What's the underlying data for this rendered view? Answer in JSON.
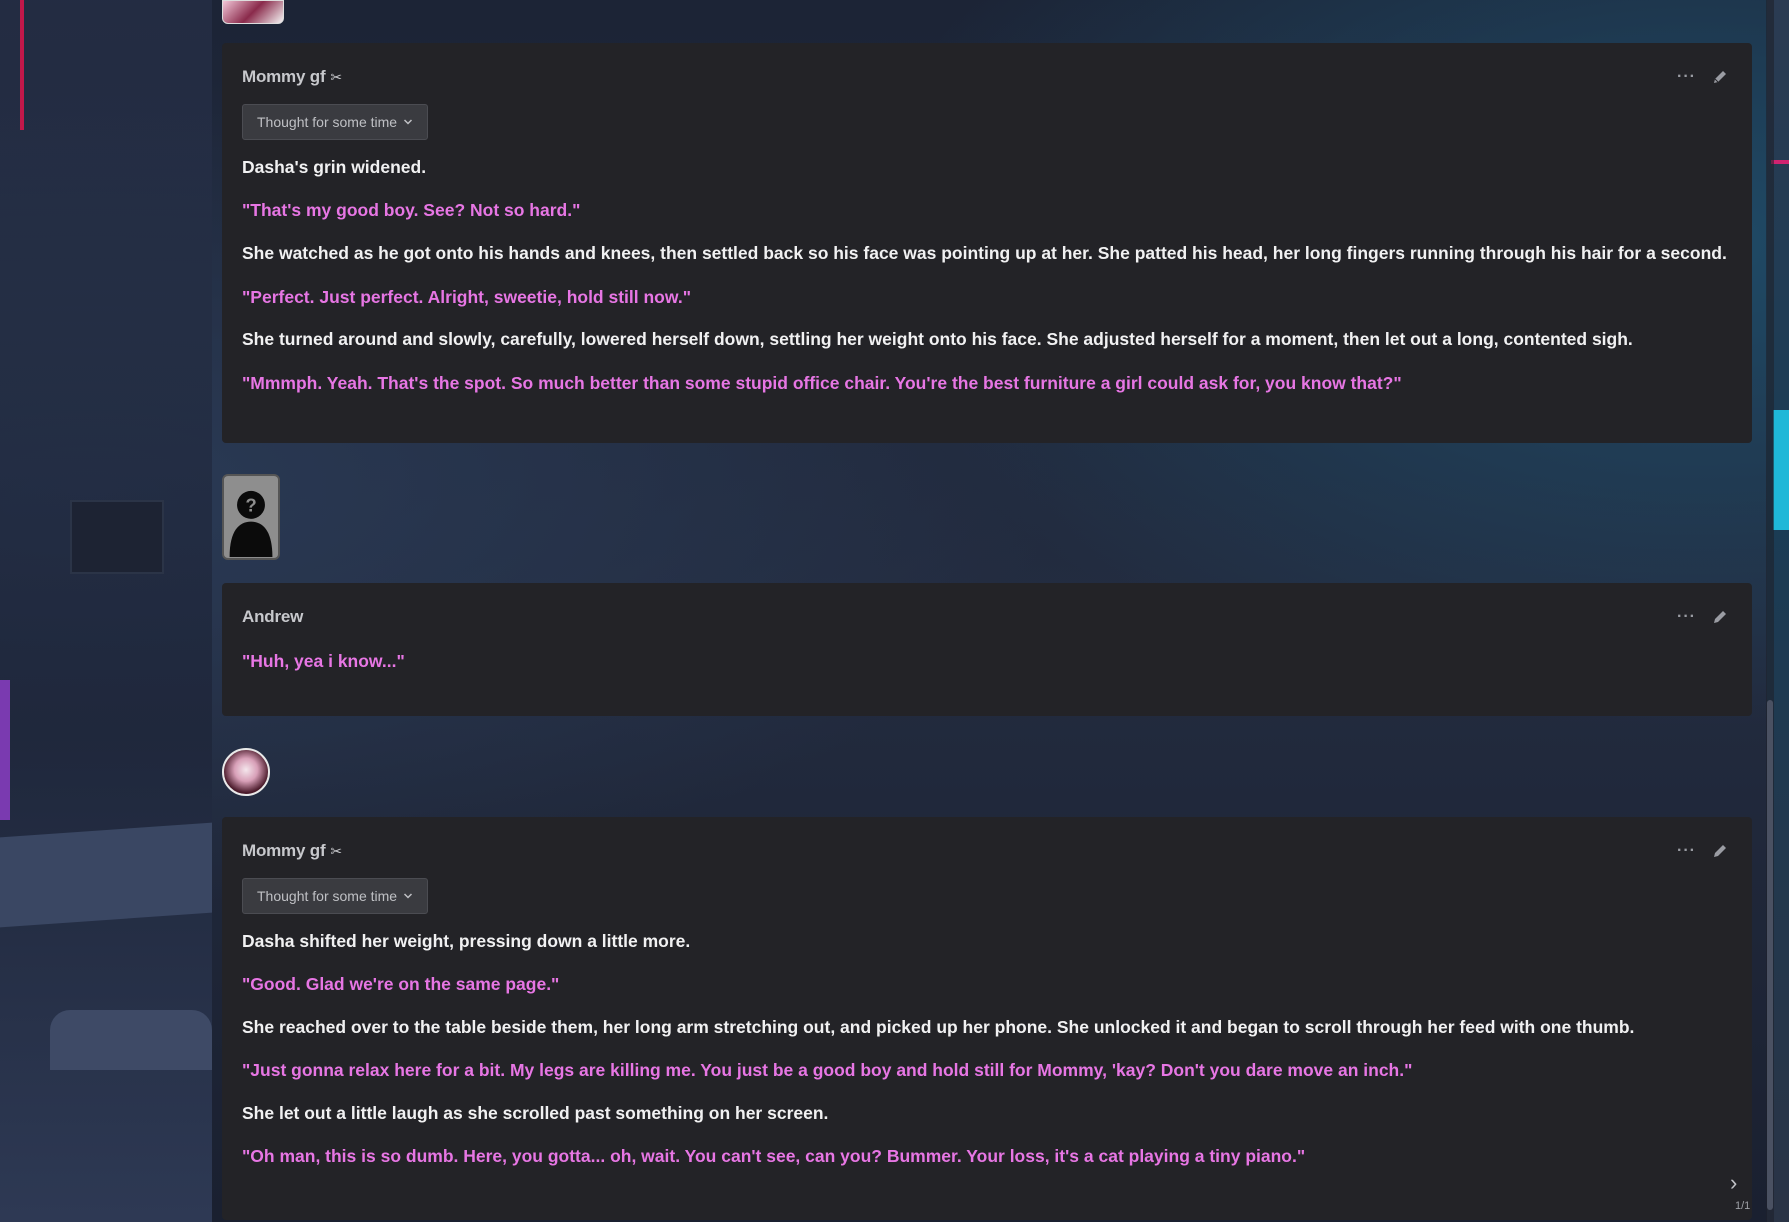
{
  "messages": [
    {
      "name": "Mommy gf",
      "name_symbol": "✂",
      "thought_label": "Thought for some time",
      "paragraphs": [
        {
          "type": "narration",
          "text": "Dasha's grin widened."
        },
        {
          "type": "speech",
          "text": "\"That's my good boy. See? Not so hard.\""
        },
        {
          "type": "narration",
          "text": "She watched as he got onto his hands and knees, then settled back so his face was pointing up at her. She patted his head, her long fingers running through his hair for a second."
        },
        {
          "type": "speech",
          "text": "\"Perfect. Just perfect. Alright, sweetie, hold still now.\""
        },
        {
          "type": "narration",
          "text": "She turned around and slowly, carefully, lowered herself down, settling her weight onto his face. She adjusted herself for a moment, then let out a long, contented sigh."
        },
        {
          "type": "speech",
          "text": "\"Mmmph. Yeah. That's the spot. So much better than some stupid office chair. You're the best furniture a girl could ask for, you know that?\""
        }
      ]
    },
    {
      "name": "Andrew",
      "paragraphs": [
        {
          "type": "speech",
          "text": "\"Huh, yea i know...\""
        }
      ]
    },
    {
      "name": "Mommy gf",
      "name_symbol": "✂",
      "thought_label": "Thought for some time",
      "paragraphs": [
        {
          "type": "narration",
          "text": "Dasha shifted her weight, pressing down a little more."
        },
        {
          "type": "speech",
          "text": "\"Good. Glad we're on the same page.\""
        },
        {
          "type": "narration",
          "text": "She reached over to the table beside them, her long arm stretching out, and picked up her phone. She unlocked it and began to scroll through her feed with one thumb."
        },
        {
          "type": "speech",
          "text": "\"Just gonna relax here for a bit. My legs are killing me. You just be a good boy and hold still for Mommy, 'kay? Don't you dare move an inch.\""
        },
        {
          "type": "narration",
          "text": "She let out a little laugh as she scrolled past something on her screen."
        },
        {
          "type": "speech",
          "text": "\"Oh man, this is so dumb. Here, you gotta... oh, wait. You can't see, can you? Bummer. Your loss, it's a cat playing a tiny piano.\""
        }
      ]
    }
  ],
  "icons": {
    "more": "more-options-icon",
    "edit": "pencil-icon",
    "chevron": "chevron-down-icon",
    "next": "chevron-right-icon"
  },
  "colors": {
    "narration": "#f1f1f2",
    "speech": "#e776e4",
    "card": "#232327"
  },
  "swipe": {
    "arrow": "›",
    "counter": "1/1"
  }
}
